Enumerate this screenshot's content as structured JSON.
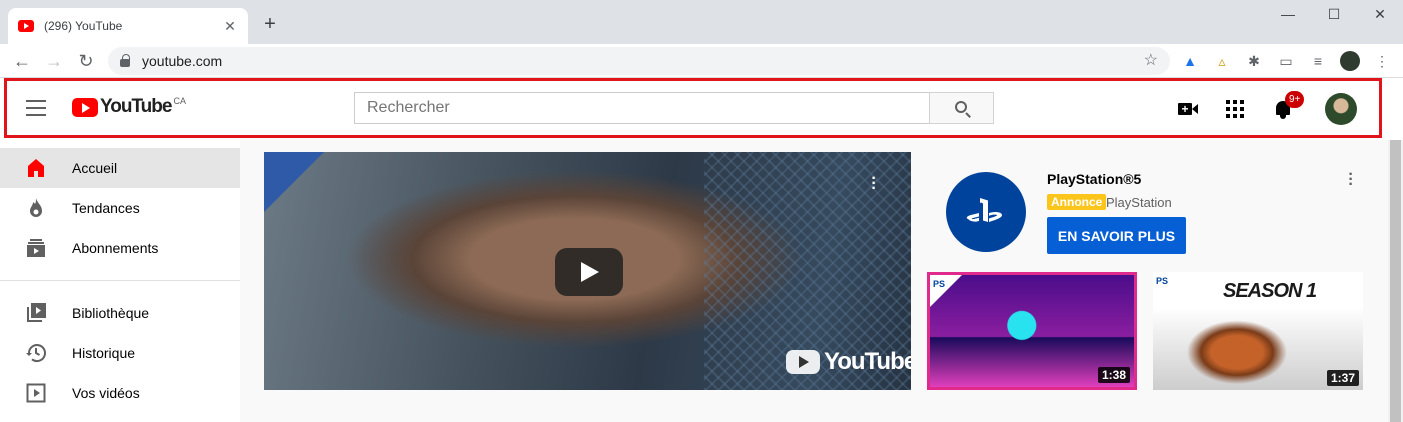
{
  "browser": {
    "tab_title": "(296) YouTube",
    "tab_close": "✕",
    "new_tab": "+",
    "window_controls": [
      "—",
      "☐",
      "✕"
    ],
    "url": "youtube.com",
    "nav": {
      "back": "←",
      "forward": "→",
      "reload": "↻"
    },
    "bookmark_star": "☆"
  },
  "header": {
    "logo_text": "YouTube",
    "logo_country": "CA",
    "search_placeholder": "Rechercher",
    "notification_count": "9+",
    "highlight_color": "#e0141b"
  },
  "sidebar": {
    "items": [
      {
        "label": "Accueil",
        "icon": "home-icon",
        "active": true
      },
      {
        "label": "Tendances",
        "icon": "fire-icon",
        "active": false
      },
      {
        "label": "Abonnements",
        "icon": "subscriptions-icon",
        "active": false
      },
      {
        "label": "Bibliothèque",
        "icon": "library-icon",
        "active": false
      },
      {
        "label": "Historique",
        "icon": "history-icon",
        "active": false
      },
      {
        "label": "Vos vidéos",
        "icon": "your-videos-icon",
        "active": false
      }
    ]
  },
  "hero": {
    "brand_text": "YouTube"
  },
  "ad": {
    "title": "PlayStation®5",
    "badge": "Annonce",
    "channel": "PlayStation",
    "cta": "EN SAVOIR PLUS",
    "brand_color": "#00439c"
  },
  "thumbnails": [
    {
      "duration": "1:38",
      "overlay_text": ""
    },
    {
      "duration": "1:37",
      "overlay_text": "SEASON 1"
    }
  ],
  "colors": {
    "youtube_red": "#ff0000",
    "cta_blue": "#065fd4",
    "active_bg": "#e5e5e5"
  }
}
